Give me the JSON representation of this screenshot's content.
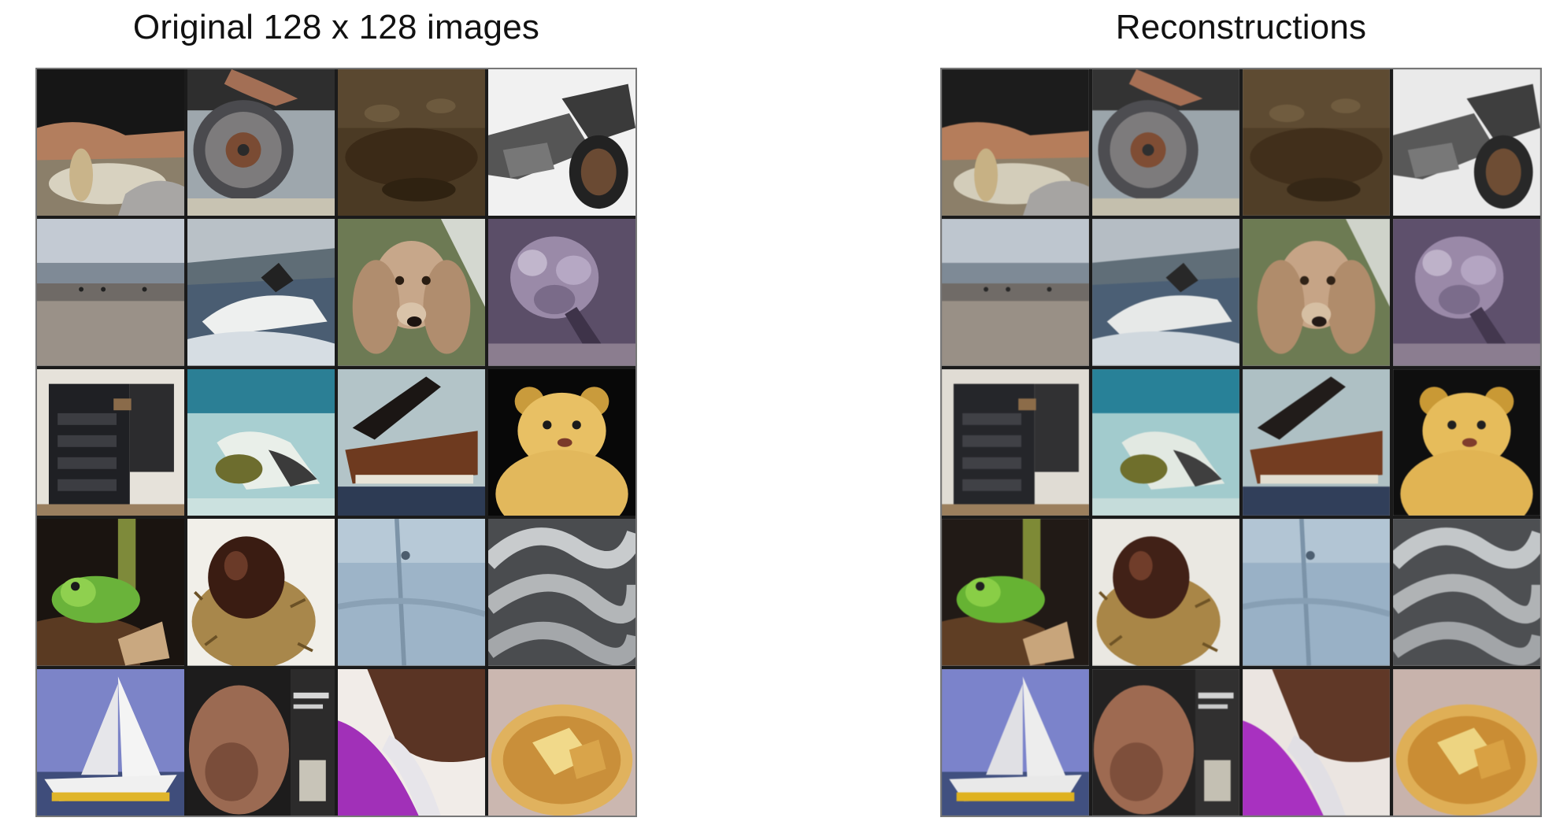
{
  "panels": [
    {
      "id": "original",
      "title": "Original 128 x 128 images"
    },
    {
      "id": "reconstructions",
      "title": "Reconstructions"
    }
  ],
  "grid": {
    "rows": 5,
    "cols": 4
  },
  "tiles": [
    {
      "name": "hands-cutting-tile",
      "icon": "hands-cutting-icon"
    },
    {
      "name": "brake-disc-tile",
      "icon": "brake-disc-icon"
    },
    {
      "name": "rust-texture-tile",
      "icon": "rust-texture-icon"
    },
    {
      "name": "binoculars-tile",
      "icon": "binoculars-icon"
    },
    {
      "name": "beach-horizon-tile",
      "icon": "beach-horizon-icon"
    },
    {
      "name": "speedboat-tile",
      "icon": "speedboat-icon"
    },
    {
      "name": "spaniel-dog-tile",
      "icon": "spaniel-dog-icon"
    },
    {
      "name": "purple-flower-tile",
      "icon": "purple-flower-icon"
    },
    {
      "name": "dresser-cabinet-tile",
      "icon": "dresser-cabinet-icon"
    },
    {
      "name": "bird-in-water-tile",
      "icon": "bird-in-water-icon"
    },
    {
      "name": "grand-piano-tile",
      "icon": "grand-piano-icon"
    },
    {
      "name": "teddy-bear-tile",
      "icon": "teddy-bear-icon"
    },
    {
      "name": "tree-frog-tile",
      "icon": "tree-frog-icon"
    },
    {
      "name": "chestnut-burr-tile",
      "icon": "chestnut-burr-icon"
    },
    {
      "name": "denim-jeans-tile",
      "icon": "denim-jeans-icon"
    },
    {
      "name": "rope-coil-tile",
      "icon": "rope-coil-icon"
    },
    {
      "name": "sailboat-tile",
      "icon": "sailboat-icon"
    },
    {
      "name": "book-cover-hand-tile",
      "icon": "book-cover-hand-icon"
    },
    {
      "name": "fabric-folds-tile",
      "icon": "fabric-folds-icon"
    },
    {
      "name": "soup-bowl-tile",
      "icon": "soup-bowl-icon"
    }
  ]
}
